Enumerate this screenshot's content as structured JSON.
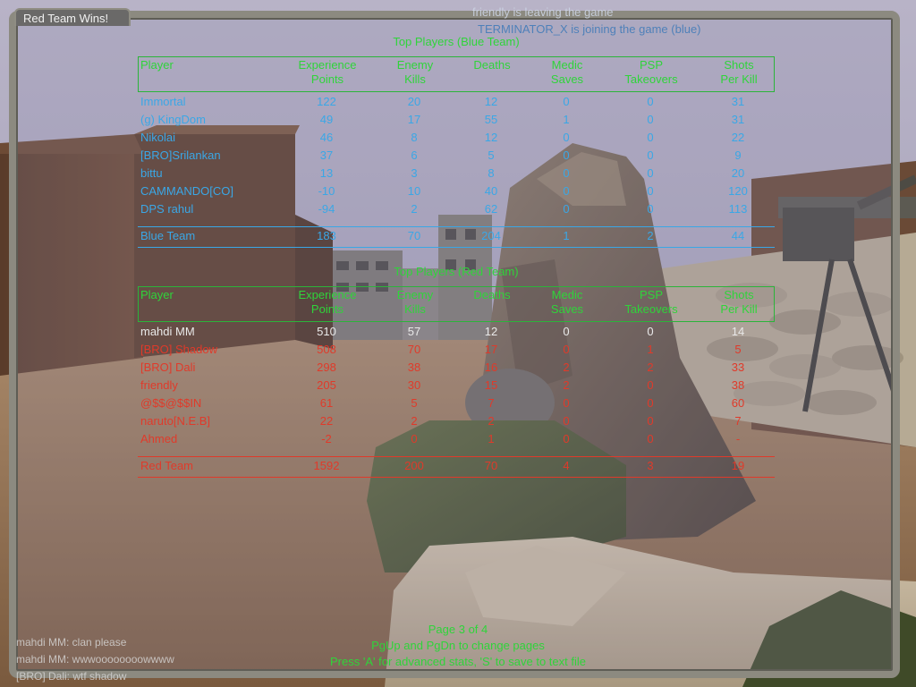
{
  "window": {
    "title": "Red Team Wins!"
  },
  "messages": [
    "friendly is leaving the game",
    "TERMINATOR_X is joining the game (blue)"
  ],
  "headers": {
    "player": "Player",
    "xp": [
      "Experience",
      "Points"
    ],
    "ek": [
      "Enemy",
      "Kills"
    ],
    "deaths": "Deaths",
    "ms": [
      "Medic",
      "Saves"
    ],
    "psp": [
      "PSP",
      "Takeovers"
    ],
    "spk": [
      "Shots",
      "Per Kill"
    ]
  },
  "blue": {
    "title": "Top Players (Blue Team)",
    "players": [
      [
        "Immortal",
        "122",
        "20",
        "12",
        "0",
        "0",
        "31"
      ],
      [
        "(g) KingDom",
        "49",
        "17",
        "55",
        "1",
        "0",
        "31"
      ],
      [
        "Nikolai",
        "46",
        "8",
        "12",
        "0",
        "0",
        "22"
      ],
      [
        "[BRO]Srilankan",
        "37",
        "6",
        "5",
        "0",
        "0",
        "9"
      ],
      [
        "bittu",
        "13",
        "3",
        "8",
        "0",
        "0",
        "20"
      ],
      [
        "CAMMANDO[CO]",
        "-10",
        "10",
        "40",
        "0",
        "0",
        "120"
      ],
      [
        "DPS rahul",
        "-94",
        "2",
        "62",
        "0",
        "0",
        "113"
      ]
    ],
    "total": [
      "Blue Team",
      "183",
      "70",
      "204",
      "1",
      "2",
      "44"
    ]
  },
  "red": {
    "title": "Top Players (Red Team)",
    "players": [
      [
        "mahdi MM",
        "510",
        "57",
        "12",
        "0",
        "0",
        "14"
      ],
      [
        "[BRO] Shadow",
        "508",
        "70",
        "17",
        "0",
        "1",
        "5"
      ],
      [
        "[BRO] Dali",
        "298",
        "38",
        "16",
        "2",
        "2",
        "33"
      ],
      [
        "friendly",
        "205",
        "30",
        "15",
        "2",
        "0",
        "38"
      ],
      [
        "@$$@$$IN",
        "61",
        "5",
        "7",
        "0",
        "0",
        "60"
      ],
      [
        "naruto[N.E.B]",
        "22",
        "2",
        "2",
        "0",
        "0",
        "7"
      ],
      [
        "Ahmed",
        "-2",
        "0",
        "1",
        "0",
        "0",
        "-"
      ]
    ],
    "total": [
      "Red Team",
      "1592",
      "200",
      "70",
      "4",
      "3",
      "19"
    ]
  },
  "footer": {
    "page": "Page 3 of 4",
    "hint1": "PgUp and PgDn to change pages",
    "hint2": "Press 'A' for advanced stats, 'S' to save to text file"
  },
  "chat": [
    "mahdi MM:  clan please",
    "mahdi MM:  wwwoooooooowwww",
    "[BRO] Dali:  wtf shadow"
  ],
  "colors": {
    "blue_team": "#3aa7e6",
    "red_team": "#e03a2a",
    "headers": "#2fd43a",
    "panel_border": "#8c8a80"
  }
}
